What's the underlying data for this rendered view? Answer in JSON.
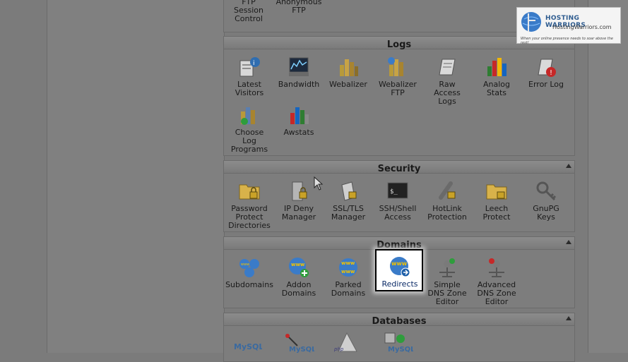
{
  "top_partial": {
    "items": [
      {
        "label": "FTP\nSession\nControl",
        "icon": "ftp-session-icon"
      },
      {
        "label": "Anonymous\nFTP",
        "icon": "anonymous-ftp-icon"
      }
    ]
  },
  "logs": {
    "title": "Logs",
    "items": [
      {
        "label": "Latest\nVisitors",
        "icon": "latest-visitors-icon"
      },
      {
        "label": "Bandwidth",
        "icon": "bandwidth-icon"
      },
      {
        "label": "Webalizer",
        "icon": "webalizer-icon"
      },
      {
        "label": "Webalizer\nFTP",
        "icon": "webalizer-ftp-icon"
      },
      {
        "label": "Raw\nAccess\nLogs",
        "icon": "raw-access-logs-icon"
      },
      {
        "label": "Analog\nStats",
        "icon": "analog-stats-icon"
      },
      {
        "label": "Error Log",
        "icon": "error-log-icon"
      },
      {
        "label": "Choose\nLog\nPrograms",
        "icon": "choose-log-programs-icon"
      },
      {
        "label": "Awstats",
        "icon": "awstats-icon"
      }
    ]
  },
  "security": {
    "title": "Security",
    "items": [
      {
        "label": "Password\nProtect\nDirectories",
        "icon": "password-protect-icon"
      },
      {
        "label": "IP Deny\nManager",
        "icon": "ip-deny-icon"
      },
      {
        "label": "SSL/TLS\nManager",
        "icon": "ssl-tls-icon"
      },
      {
        "label": "SSH/Shell\nAccess",
        "icon": "ssh-shell-icon"
      },
      {
        "label": "HotLink\nProtection",
        "icon": "hotlink-icon"
      },
      {
        "label": "Leech\nProtect",
        "icon": "leech-protect-icon"
      },
      {
        "label": "GnuPG\nKeys",
        "icon": "gnupg-keys-icon"
      }
    ]
  },
  "domains": {
    "title": "Domains",
    "items": [
      {
        "label": "Subdomains",
        "icon": "subdomains-icon"
      },
      {
        "label": "Addon\nDomains",
        "icon": "addon-domains-icon"
      },
      {
        "label": "Parked\nDomains",
        "icon": "parked-domains-icon"
      },
      {
        "label": "Redirects",
        "icon": "redirects-icon"
      },
      {
        "label": "Simple\nDNS Zone\nEditor",
        "icon": "simple-dns-icon"
      },
      {
        "label": "Advanced\nDNS Zone\nEditor",
        "icon": "advanced-dns-icon"
      }
    ]
  },
  "databases": {
    "title": "Databases"
  },
  "logo": {
    "title": "HOSTING WARRIORS",
    "url": "HostingWarriors.com",
    "tagline": "When your online presence needs to soar above the rest!"
  },
  "colors": {
    "accent_blue": "#2d5b8f",
    "highlight_border": "#000000",
    "panel_bg": "#7d7d7d"
  }
}
